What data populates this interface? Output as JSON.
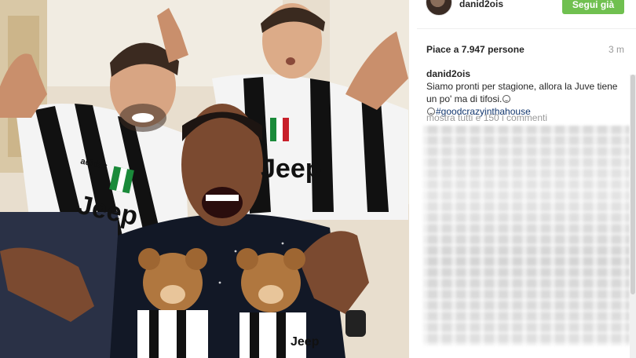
{
  "post": {
    "photo_icon": "photo"
  },
  "header": {
    "username": "danid2ois",
    "follow_label": "Segui già"
  },
  "stats": {
    "likes": "Piace a 7.947 persone",
    "time": "3 m"
  },
  "caption": {
    "author": "danid2ois",
    "text": "Siamo pronti per stagione, allora la Juve tiene un po' ma di tifosi.",
    "hashtag": "#goodcrazyinthahouse"
  },
  "comments": {
    "view_all": "mostra tutti e 150 i commenti"
  },
  "photo_text": {
    "sponsor_1": "Jeep",
    "sponsor_2": "Jeep",
    "sponsor_3": "Jeep",
    "brand": "adidas"
  },
  "colors": {
    "follow_green": "#70c050",
    "hashtag_blue": "#12376f",
    "muted_gray": "#999999"
  }
}
